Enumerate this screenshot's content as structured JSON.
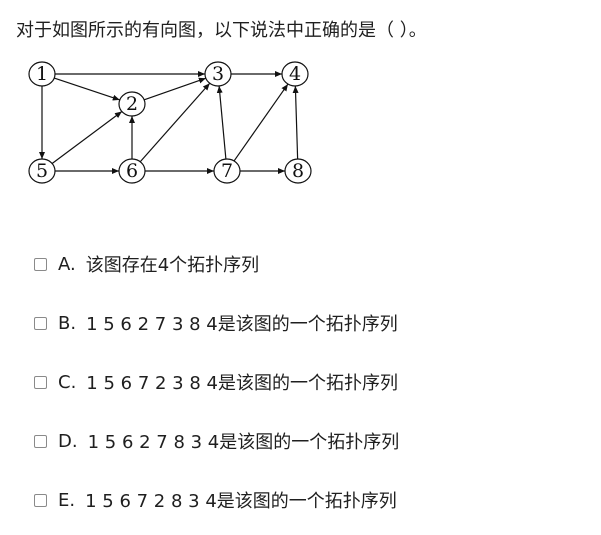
{
  "question": {
    "text": "对于如图所示的有向图，以下说法中正确的是（    ）。"
  },
  "graph": {
    "nodes": [
      {
        "id": "1",
        "label": "1"
      },
      {
        "id": "2",
        "label": "2"
      },
      {
        "id": "3",
        "label": "3"
      },
      {
        "id": "4",
        "label": "4"
      },
      {
        "id": "5",
        "label": "5"
      },
      {
        "id": "6",
        "label": "6"
      },
      {
        "id": "7",
        "label": "7"
      },
      {
        "id": "8",
        "label": "8"
      }
    ],
    "edges": [
      [
        "1",
        "3"
      ],
      [
        "1",
        "2"
      ],
      [
        "1",
        "5"
      ],
      [
        "2",
        "3"
      ],
      [
        "3",
        "4"
      ],
      [
        "5",
        "2"
      ],
      [
        "5",
        "6"
      ],
      [
        "6",
        "2"
      ],
      [
        "6",
        "3"
      ],
      [
        "6",
        "7"
      ],
      [
        "7",
        "3"
      ],
      [
        "7",
        "4"
      ],
      [
        "7",
        "8"
      ],
      [
        "8",
        "4"
      ]
    ]
  },
  "options": [
    {
      "letter": "A.",
      "text": "该图存在4个拓扑序列"
    },
    {
      "letter": "B.",
      "text": "1 5 6 2 7 3 8 4是该图的一个拓扑序列"
    },
    {
      "letter": "C.",
      "text": "1 5 6 7 2 3 8 4是该图的一个拓扑序列"
    },
    {
      "letter": "D.",
      "text": "1 5 6 2 7 8 3 4是该图的一个拓扑序列"
    },
    {
      "letter": "E.",
      "text": "1 5 6 7 2 8 3 4是该图的一个拓扑序列"
    }
  ]
}
